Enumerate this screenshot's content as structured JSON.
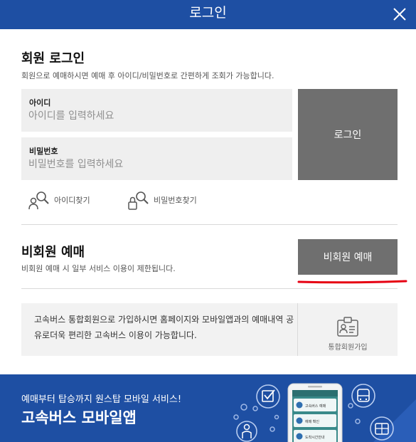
{
  "header": {
    "title": "로그인"
  },
  "member": {
    "title": "회원 로그인",
    "desc": "회원으로 예매하시면 예매 후 아이디/비밀번호로 간편하게 조회가 가능합니다.",
    "id_label": "아이디",
    "id_placeholder": "아이디를 입력하세요",
    "pw_label": "비밀번호",
    "pw_placeholder": "비밀번호를 입력하세요",
    "login_label": "로그인",
    "find_id": "아이디찾기",
    "find_pw": "비밀번호찾기"
  },
  "guest": {
    "title": "비회원 예매",
    "desc": "비회원 예매 시 일부 서비스 이용이 제한됩니다.",
    "button": "비회원 예매"
  },
  "join": {
    "text": "고속버스 통합회원으로 가입하시면 홈페이지와 모바일앱과의 예매내역 공유로더욱 편리한 고속버스 이용이 가능합니다.",
    "button": "통합회원가입"
  },
  "banner": {
    "sub": "예매부터 탑승까지 원스탑 모바일 서비스!",
    "title": "고속버스 모바일앱",
    "phone_item_1": "고속버스 예매",
    "phone_item_2": "예매 확인",
    "phone_item_3": "도착시간안내"
  },
  "colors": {
    "brand_blue": "#1e4fa3",
    "button_gray": "#6f6f6f",
    "field_bg": "#efefef",
    "underline_red": "#e60012"
  }
}
